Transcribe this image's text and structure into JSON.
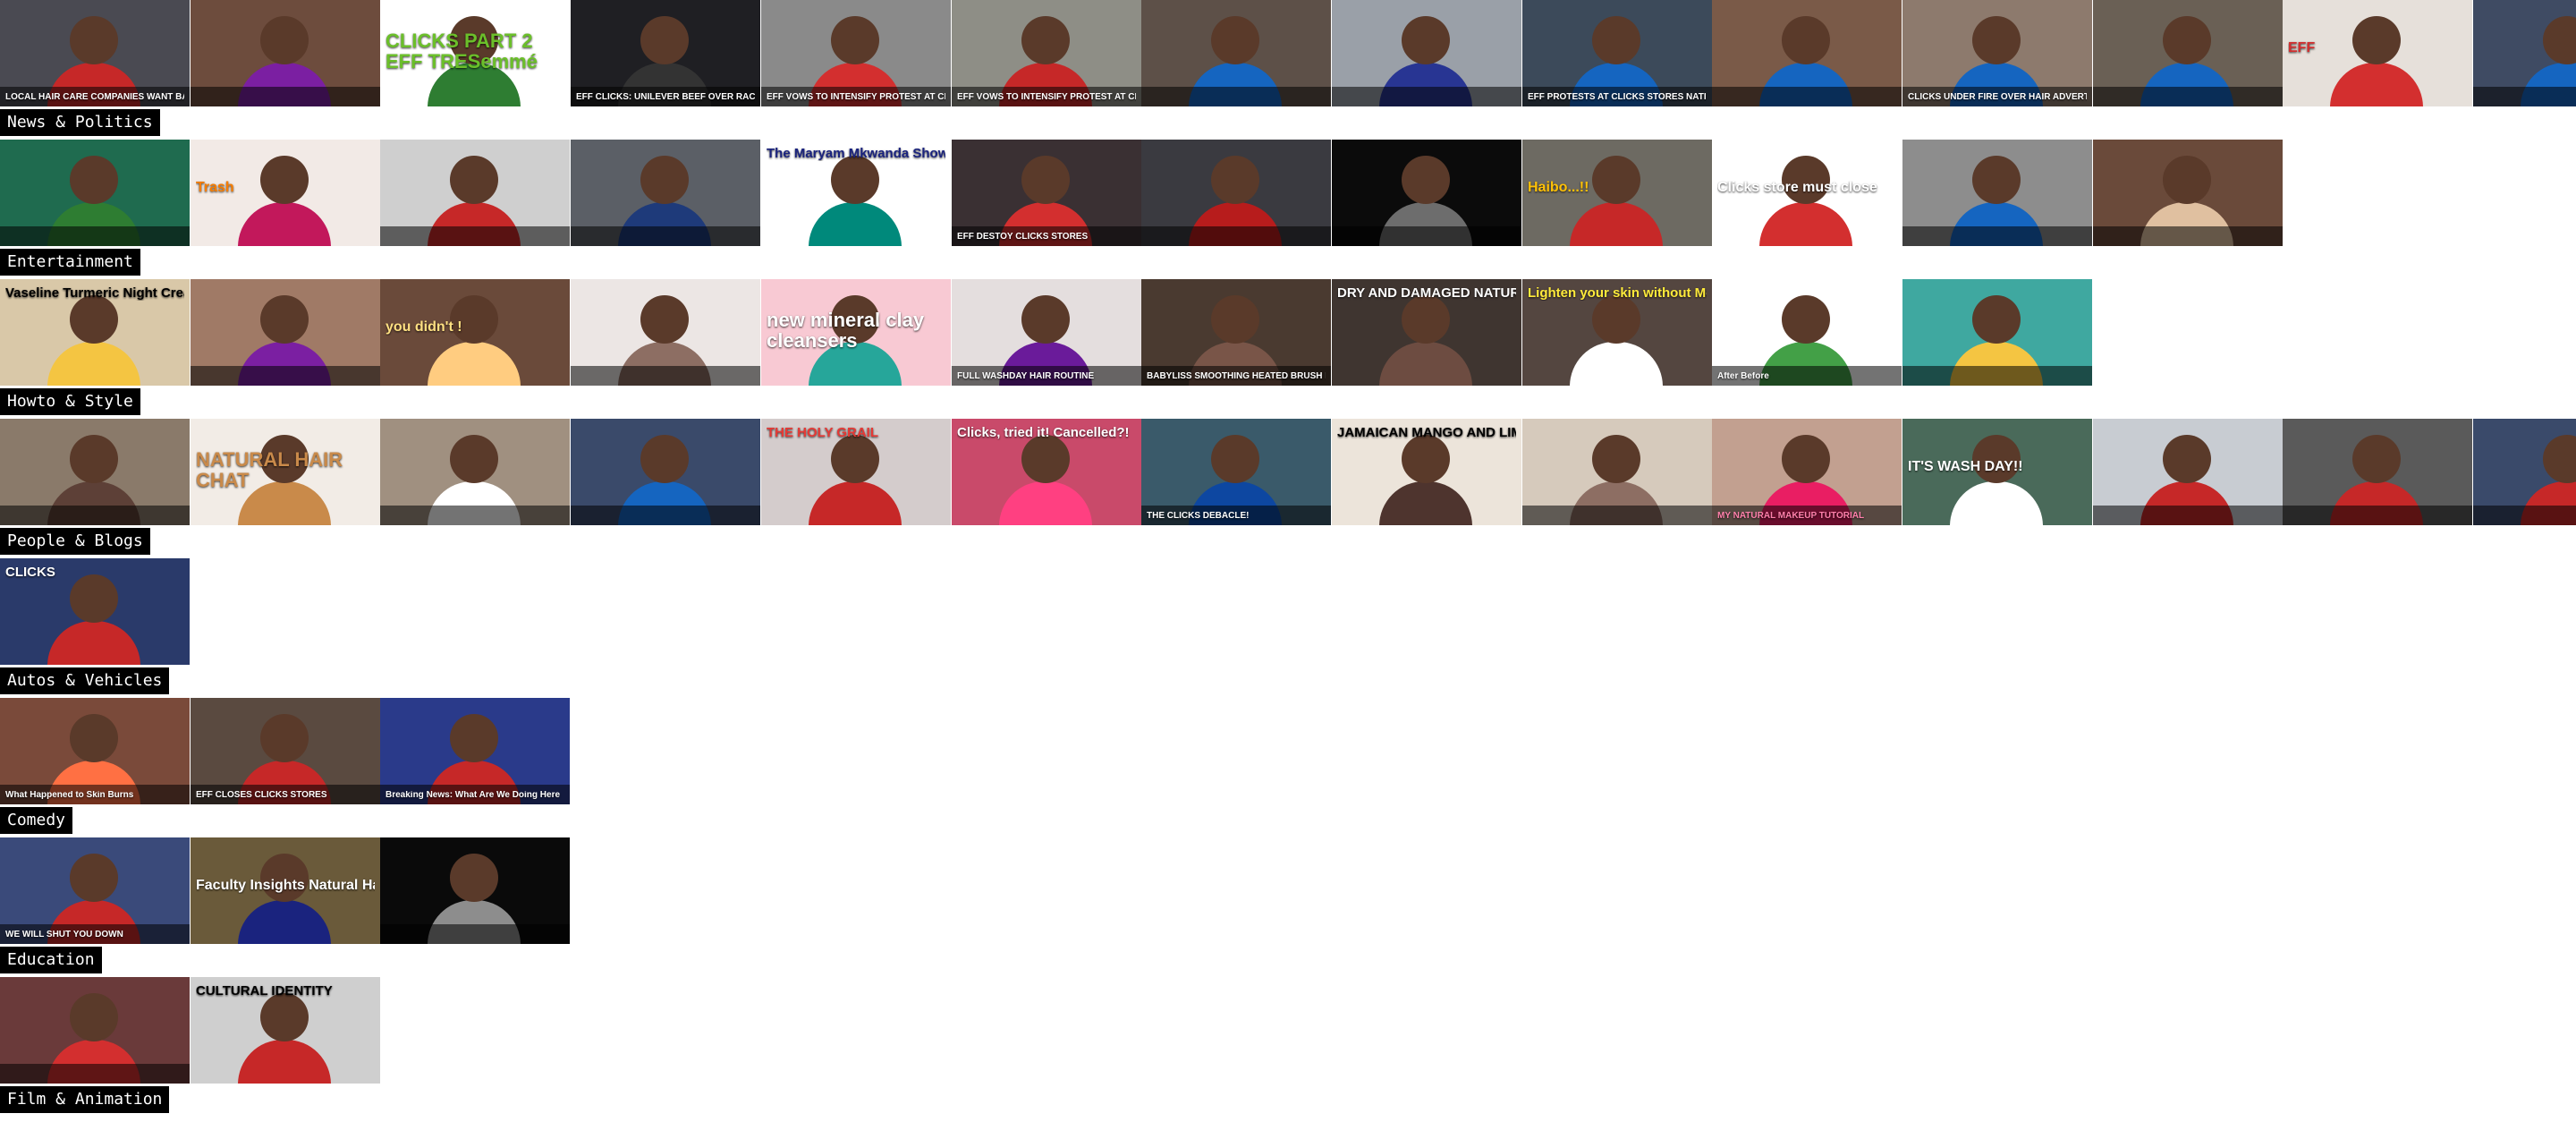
{
  "categories": [
    {
      "label": "News & Politics",
      "thumbs": [
        {
          "bg": "#4a4a52",
          "accent": "#c62828",
          "text": "LOCAL HAIR CARE COMPANIES WANT BANNED",
          "style": "bottom",
          "tc": "#ffffff"
        },
        {
          "bg": "#6d4c3d",
          "accent": "#7b1fa2",
          "text": "",
          "style": "bottom",
          "tc": "#ffffff"
        },
        {
          "bg": "#ffffff",
          "accent": "#2e7d32",
          "text": "CLICKS PART 2 EFF TRESemmé",
          "style": "big",
          "tc": "#6bbf2a"
        },
        {
          "bg": "#1f1f23",
          "accent": "#333333",
          "text": "EFF CLICKS: UNILEVER BEEF OVER RACIST ADVERT",
          "style": "bottom",
          "tc": "#ffffff"
        },
        {
          "bg": "#8a8a8a",
          "accent": "#d32f2f",
          "text": "EFF VOWS TO INTENSIFY PROTEST AT CLICKS STORES",
          "style": "bottom",
          "tc": "#ffffff"
        },
        {
          "bg": "#8e8e86",
          "accent": "#c62828",
          "text": "EFF VOWS TO INTENSIFY PROTEST AT CLICKS STORES",
          "style": "bottom",
          "tc": "#ffffff"
        },
        {
          "bg": "#5d5048",
          "accent": "#1565c0",
          "text": "",
          "style": "bottom",
          "tc": "#ffffff"
        },
        {
          "bg": "#9aa0a8",
          "accent": "#283593",
          "text": "",
          "style": "bottom",
          "tc": "#ffffff"
        },
        {
          "bg": "#3c4a5a",
          "accent": "#1565c0",
          "text": "EFF PROTESTS AT CLICKS STORES NATIONWIDE",
          "style": "bottom",
          "tc": "#ffffff"
        },
        {
          "bg": "#7a5a48",
          "accent": "#1565c0",
          "text": "",
          "style": "bottom",
          "tc": "#ffffff"
        },
        {
          "bg": "#8d7a6d",
          "accent": "#1565c0",
          "text": "CLICKS UNDER FIRE OVER HAIR ADVERT",
          "style": "bottom",
          "tc": "#ffffff"
        },
        {
          "bg": "#6a6055",
          "accent": "#1565c0",
          "text": "",
          "style": "bottom",
          "tc": "#ffffff"
        },
        {
          "bg": "#e6e0da",
          "accent": "#d32f2f",
          "text": "EFF",
          "style": "mid",
          "tc": "#d32f2f"
        },
        {
          "bg": "#3f4b63",
          "accent": "#1565c0",
          "text": "",
          "style": "bottom",
          "tc": "#ffffff"
        }
      ]
    },
    {
      "label": "Entertainment",
      "thumbs": [
        {
          "bg": "#1f6b4f",
          "accent": "#2e7d32",
          "text": "",
          "style": "bottom",
          "tc": "#ffffff"
        },
        {
          "bg": "#f2eae6",
          "accent": "#c2185b",
          "text": "Trash",
          "style": "mid",
          "tc": "#f57c00"
        },
        {
          "bg": "#cfcfcf",
          "accent": "#c62828",
          "text": "",
          "style": "bottom",
          "tc": "#ffffff"
        },
        {
          "bg": "#5b5f66",
          "accent": "#1e3a7a",
          "text": "",
          "style": "bottom",
          "tc": "#ffffff"
        },
        {
          "bg": "#ffffff",
          "accent": "#00897b",
          "text": "The Maryam Mkwanda Show",
          "style": "top",
          "tc": "#1a237e"
        },
        {
          "bg": "#3a3033",
          "accent": "#d32f2f",
          "text": "EFF DESTOY CLICKS STORES",
          "style": "bottom",
          "tc": "#ffffff"
        },
        {
          "bg": "#3a3a40",
          "accent": "#b71c1c",
          "text": "",
          "style": "bottom",
          "tc": "#ffffff"
        },
        {
          "bg": "#0b0b0b",
          "accent": "#6d6d6d",
          "text": "",
          "style": "bottom",
          "tc": "#ffffff"
        },
        {
          "bg": "#6d6a62",
          "accent": "#c62828",
          "text": "Haibo...!!",
          "style": "mid",
          "tc": "#ffc107"
        },
        {
          "bg": "#ffffff",
          "accent": "#d32f2f",
          "text": "Clicks store must close",
          "style": "mid",
          "tc": "#ffffff"
        },
        {
          "bg": "#8d8d8d",
          "accent": "#1565c0",
          "text": "",
          "style": "bottom",
          "tc": "#ffffff"
        },
        {
          "bg": "#6a4a3a",
          "accent": "#e0c0a0",
          "text": "",
          "style": "bottom",
          "tc": "#ffffff"
        }
      ]
    },
    {
      "label": "Howto & Style",
      "thumbs": [
        {
          "bg": "#d9c8a8",
          "accent": "#f4c542",
          "text": "Vaseline Turmeric Night Cream Dark Spots",
          "style": "top",
          "tc": "#000000"
        },
        {
          "bg": "#a07a66",
          "accent": "#7b1fa2",
          "text": "",
          "style": "bottom",
          "tc": "#ffffff"
        },
        {
          "bg": "#6a4a3a",
          "accent": "#ffcc80",
          "text": "you didn't !",
          "style": "mid",
          "tc": "#ffe082"
        },
        {
          "bg": "#ece6e4",
          "accent": "#8d6e63",
          "text": "",
          "style": "bottom",
          "tc": "#ffffff"
        },
        {
          "bg": "#f8c9d3",
          "accent": "#26a69a",
          "text": "new mineral clay cleansers",
          "style": "big",
          "tc": "#ffffff"
        },
        {
          "bg": "#e4dede",
          "accent": "#6a1b9a",
          "text": "FULL WASHDAY HAIR ROUTINE",
          "style": "bottom",
          "tc": "#ffffff"
        },
        {
          "bg": "#4a3a30",
          "accent": "#795548",
          "text": "BABYLISS SMOOTHING HEATED BRUSH REVIEW",
          "style": "bottom",
          "tc": "#ffffff"
        },
        {
          "bg": "#3f3530",
          "accent": "#6d4c41",
          "text": "DRY AND DAMAGED NATURAL HAIR",
          "style": "top",
          "tc": "#ffffff"
        },
        {
          "bg": "#544640",
          "accent": "#ffffff",
          "text": "Lighten your skin without Mercury",
          "style": "top",
          "tc": "#ffeb3b"
        },
        {
          "bg": "#ffffff",
          "accent": "#43a047",
          "text": "After Before",
          "style": "bottom",
          "tc": "#ffffff"
        },
        {
          "bg": "#3fa8a0",
          "accent": "#f4c542",
          "text": "",
          "style": "bottom",
          "tc": "#ffffff"
        }
      ]
    },
    {
      "label": "People & Blogs",
      "thumbs": [
        {
          "bg": "#8a7a6a",
          "accent": "#5d4037",
          "text": "",
          "style": "bottom",
          "tc": "#ffffff"
        },
        {
          "bg": "#f2ece6",
          "accent": "#c98a4a",
          "text": "NATURAL HAIR CHAT",
          "style": "big",
          "tc": "#c98a4a"
        },
        {
          "bg": "#a09080",
          "accent": "#ffffff",
          "text": "",
          "style": "bottom",
          "tc": "#ffffff"
        },
        {
          "bg": "#3a4a6a",
          "accent": "#1565c0",
          "text": "",
          "style": "bottom",
          "tc": "#ffffff"
        },
        {
          "bg": "#d4cccc",
          "accent": "#c62828",
          "text": "THE HOLY GRAIL",
          "style": "top",
          "tc": "#e53935"
        },
        {
          "bg": "#c94a6a",
          "accent": "#ff4081",
          "text": "Clicks, tried it! Cancelled?!",
          "style": "top",
          "tc": "#ffffff"
        },
        {
          "bg": "#3a5a6a",
          "accent": "#0d47a1",
          "text": "THE CLICKS DEBACLE!",
          "style": "bottom",
          "tc": "#ffffff"
        },
        {
          "bg": "#ece4da",
          "accent": "#4e342e",
          "text": "JAMAICAN MANGO AND LIME Product Review",
          "style": "top",
          "tc": "#000000"
        },
        {
          "bg": "#d6cabc",
          "accent": "#8d6e63",
          "text": "",
          "style": "bottom",
          "tc": "#ffffff"
        },
        {
          "bg": "#c2a090",
          "accent": "#e91e63",
          "text": "MY NATURAL MAKEUP TUTORIAL",
          "style": "bottom",
          "tc": "#ff80ab"
        },
        {
          "bg": "#4a6a5a",
          "accent": "#ffffff",
          "text": "IT'S WASH DAY!!",
          "style": "mid",
          "tc": "#ffffff"
        },
        {
          "bg": "#c8ccd2",
          "accent": "#c62828",
          "text": "",
          "style": "bottom",
          "tc": "#ffffff"
        },
        {
          "bg": "#5a5a5a",
          "accent": "#c62828",
          "text": "",
          "style": "bottom",
          "tc": "#ffffff"
        },
        {
          "bg": "#3a4a6a",
          "accent": "#c62828",
          "text": "",
          "style": "bottom",
          "tc": "#ffffff"
        }
      ]
    },
    {
      "label": "Autos & Vehicles",
      "thumbs": [
        {
          "bg": "#2a3a6a",
          "accent": "#c62828",
          "text": "CLICKS",
          "style": "top",
          "tc": "#ffffff"
        }
      ]
    },
    {
      "label": "Comedy",
      "thumbs": [
        {
          "bg": "#7a4a3a",
          "accent": "#ff7043",
          "text": "What Happened to Skin Burns",
          "style": "bottom",
          "tc": "#ffffff"
        },
        {
          "bg": "#5a4a40",
          "accent": "#c62828",
          "text": "EFF CLOSES CLICKS STORES",
          "style": "bottom",
          "tc": "#ffffff"
        },
        {
          "bg": "#2a3a8a",
          "accent": "#c62828",
          "text": "Breaking News: What Are We Doing Here",
          "style": "bottom",
          "tc": "#ffffff"
        }
      ]
    },
    {
      "label": "Education",
      "thumbs": [
        {
          "bg": "#3a4a7a",
          "accent": "#c62828",
          "text": "WE WILL SHUT YOU DOWN",
          "style": "bottom",
          "tc": "#ffffff"
        },
        {
          "bg": "#6a5a3a",
          "accent": "#1a237e",
          "text": "Faculty Insights Natural Hair Bias",
          "style": "mid",
          "tc": "#ffffff"
        },
        {
          "bg": "#0a0a0a",
          "accent": "#8d8d8d",
          "text": "",
          "style": "bottom",
          "tc": "#ffffff"
        }
      ]
    },
    {
      "label": "Film & Animation",
      "thumbs": [
        {
          "bg": "#6a3a3a",
          "accent": "#d32f2f",
          "text": "",
          "style": "bottom",
          "tc": "#ffffff"
        },
        {
          "bg": "#cfcfcf",
          "accent": "#c62828",
          "text": "CULTURAL IDENTITY",
          "style": "top",
          "tc": "#000000"
        }
      ]
    }
  ]
}
